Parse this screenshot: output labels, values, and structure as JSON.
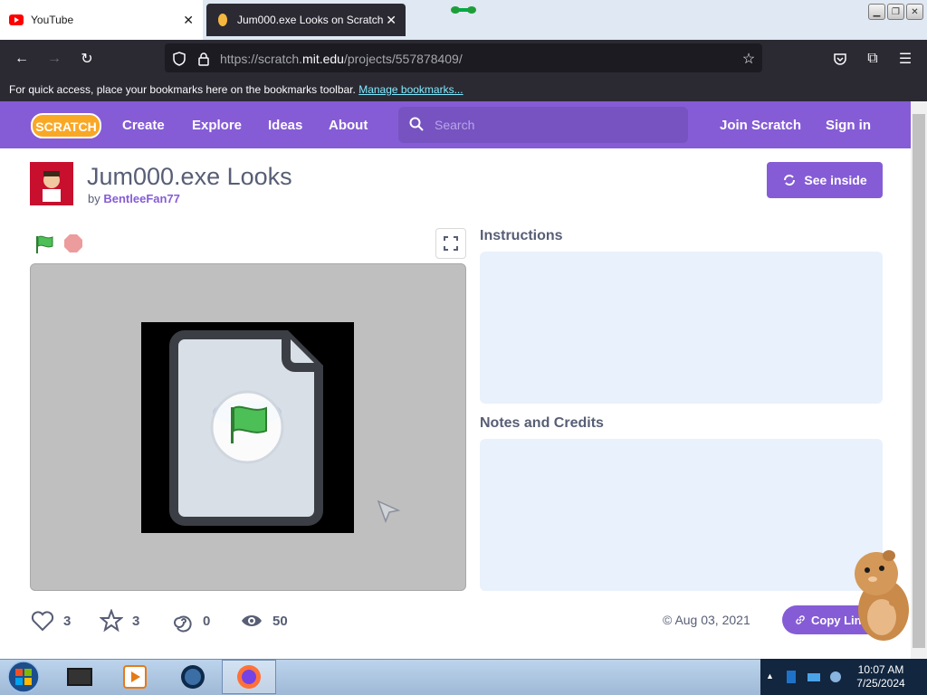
{
  "browser": {
    "tabs": [
      {
        "title": "YouTube",
        "active": false
      },
      {
        "title": "Jum000.exe Looks on Scratch",
        "active": true
      }
    ],
    "url_prefix": "https://scratch.",
    "url_host": "mit.edu",
    "url_path": "/projects/557878409/",
    "bookmarks_hint": "For quick access, place your bookmarks here on the bookmarks toolbar.",
    "bookmarks_link": "Manage bookmarks..."
  },
  "scratch_nav": {
    "logo_text": "SCRATCH",
    "links": [
      "Create",
      "Explore",
      "Ideas",
      "About"
    ],
    "search_placeholder": "Search",
    "join": "Join Scratch",
    "signin": "Sign in"
  },
  "project": {
    "title": "Jum000.exe Looks",
    "by_prefix": "by",
    "author": "BentleeFan77",
    "see_inside": "See inside",
    "instructions_title": "Instructions",
    "notes_title": "Notes and Credits",
    "stats": {
      "loves": "3",
      "favorites": "3",
      "remixes": "0",
      "views": "50"
    },
    "date": "Aug 03, 2021",
    "copy_link": "Copy Link"
  },
  "taskbar": {
    "time": "10:07 AM",
    "date": "7/25/2024"
  },
  "colors": {
    "scratch_purple": "#855cd6",
    "panel_bg": "#e9f1fc",
    "browser_dark": "#2b2a33"
  }
}
